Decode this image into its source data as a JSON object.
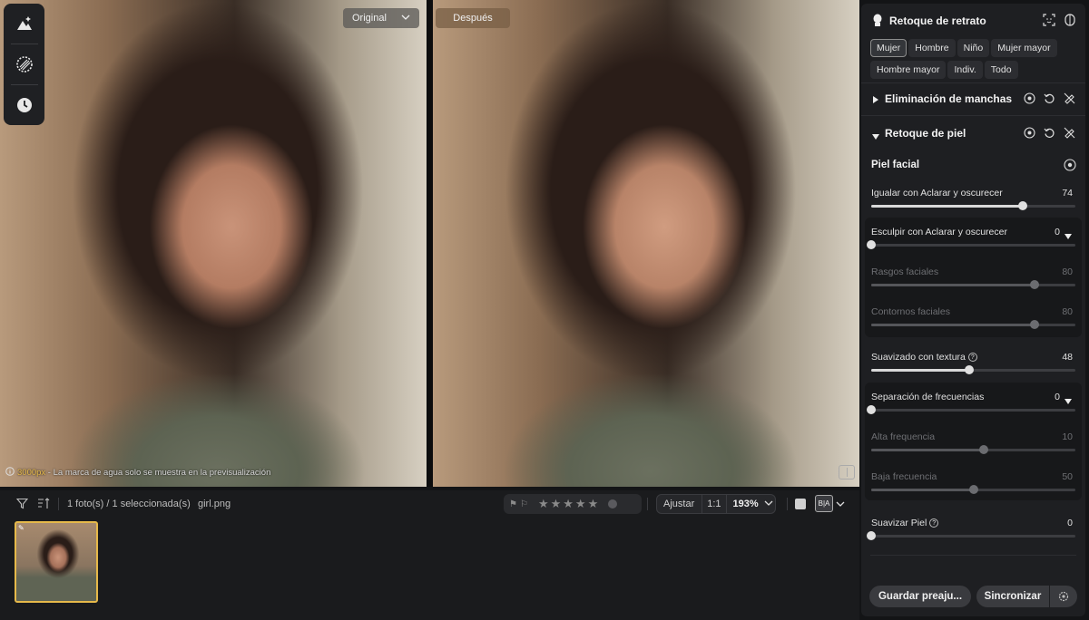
{
  "viewer": {
    "tag_original": "Original",
    "tag_after": "Después",
    "note_highlight": "3000px",
    "note_text": " - La marca de agua solo se muestra en la previsualización"
  },
  "bottom": {
    "count": "1 foto(s) / 1 seleccionada(s)",
    "filename": "girl.png",
    "fit": "Ajustar",
    "one_to_one": "1:1",
    "zoom": "193%",
    "rating": 0
  },
  "panel": {
    "title": "Retoque de retrato",
    "chips": [
      "Mujer",
      "Hombre",
      "Niño",
      "Mujer mayor",
      "Hombre mayor",
      "Indiv.",
      "Todo"
    ],
    "active_chip": "Mujer",
    "section_spots": "Eliminación de manchas",
    "section_skin": "Retoque de piel",
    "facial_skin": "Piel facial",
    "sliders": {
      "igualar": {
        "label": "Igualar con Aclarar y oscurecer",
        "value": "74",
        "fraction": 0.74
      },
      "esculpir": {
        "label": "Esculpir con Aclarar y oscurecer",
        "value": "0",
        "fraction": 0
      },
      "rasgos": {
        "label": "Rasgos faciales",
        "value": "80",
        "fraction": 0.8
      },
      "contornos": {
        "label": "Contornos faciales",
        "value": "80",
        "fraction": 0.8
      },
      "suavizado": {
        "label": "Suavizado con textura",
        "value": "48",
        "fraction": 0.48
      },
      "separacion": {
        "label": "Separación de frecuencias",
        "value": "0",
        "fraction": 0
      },
      "alta": {
        "label": "Alta frequencia",
        "value": "10",
        "fraction": 0.55
      },
      "baja": {
        "label": "Baja frecuencia",
        "value": "50",
        "fraction": 0.5
      },
      "suavizar": {
        "label": "Suavizar Piel",
        "value": "0",
        "fraction": 0
      }
    },
    "save_preset": "Guardar preaju...",
    "sync": "Sincronizar"
  },
  "colors": {
    "accent": "#e6b94a"
  }
}
